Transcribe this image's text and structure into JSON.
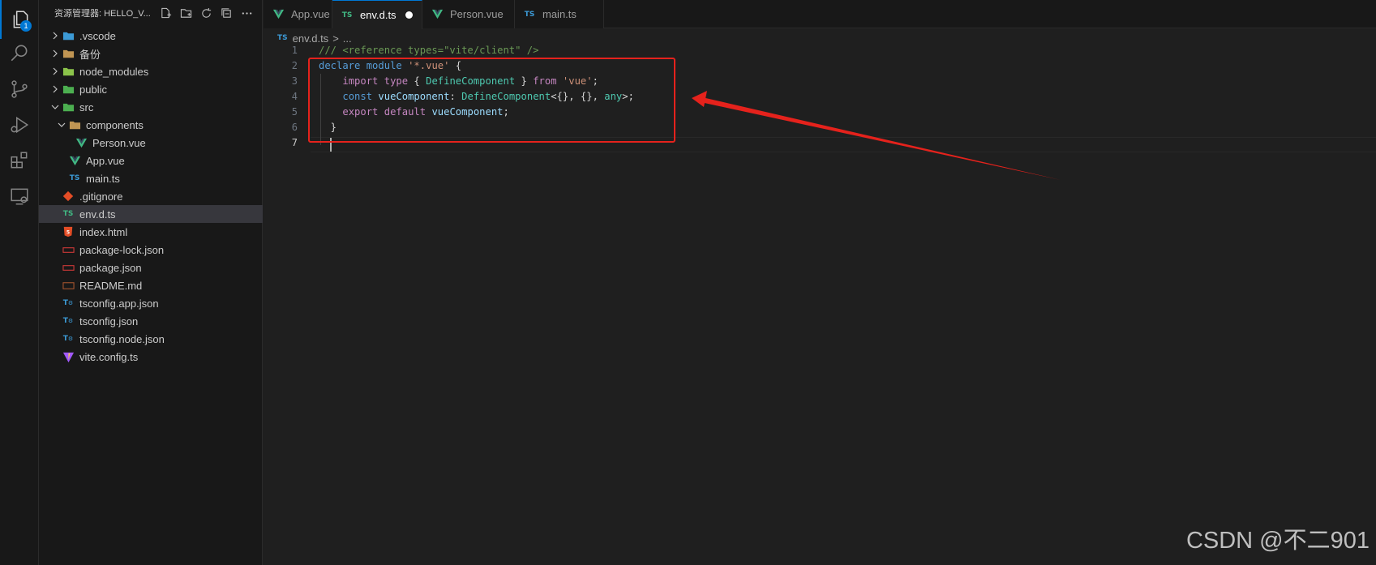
{
  "activity_bar": {
    "explorer_badge": "1",
    "items": [
      "explorer-icon",
      "search-icon",
      "source-control-icon",
      "run-debug-icon",
      "extensions-icon",
      "remote-explorer-icon"
    ]
  },
  "sidebar": {
    "title": "资源管理器: HELLO_V...",
    "actions": [
      "new-file-icon",
      "new-folder-icon",
      "refresh-icon",
      "collapse-all-icon",
      "more-icon"
    ],
    "tree": [
      {
        "label": ".vscode",
        "type": "folder",
        "expanded": false,
        "indent": 0,
        "icon": "vscode-folder-icon",
        "color": "#3c9ad6"
      },
      {
        "label": "备份",
        "type": "folder",
        "expanded": false,
        "indent": 0,
        "icon": "folder-icon",
        "color": "#c09553"
      },
      {
        "label": "node_modules",
        "type": "folder",
        "expanded": false,
        "indent": 0,
        "icon": "node-folder-icon",
        "color": "#8bc34a"
      },
      {
        "label": "public",
        "type": "folder",
        "expanded": false,
        "indent": 0,
        "icon": "public-folder-icon",
        "color": "#4caf50"
      },
      {
        "label": "src",
        "type": "folder",
        "expanded": true,
        "indent": 0,
        "icon": "src-folder-icon",
        "color": "#4caf50"
      },
      {
        "label": "components",
        "type": "folder",
        "expanded": true,
        "indent": 1,
        "icon": "components-folder-icon",
        "color": "#c09553"
      },
      {
        "label": "Person.vue",
        "type": "file",
        "indent": 2,
        "icon": "vue-file-icon",
        "color": "#41b883"
      },
      {
        "label": "App.vue",
        "type": "file",
        "indent": 1,
        "icon": "vue-file-icon",
        "color": "#41b883"
      },
      {
        "label": "main.ts",
        "type": "file",
        "indent": 1,
        "icon": "ts-file-icon",
        "color": "#3c9ad6"
      },
      {
        "label": ".gitignore",
        "type": "file",
        "indent": 0,
        "icon": "git-file-icon",
        "color": "#e44d26"
      },
      {
        "label": "env.d.ts",
        "type": "file",
        "indent": 0,
        "icon": "ts-file-icon",
        "color": "#41b883",
        "selected": true
      },
      {
        "label": "index.html",
        "type": "file",
        "indent": 0,
        "icon": "html-file-icon",
        "color": "#e44d26"
      },
      {
        "label": "package-lock.json",
        "type": "file",
        "indent": 0,
        "icon": "npm-file-icon",
        "color": "#cb3837"
      },
      {
        "label": "package.json",
        "type": "file",
        "indent": 0,
        "icon": "npm-file-icon",
        "color": "#cb3837"
      },
      {
        "label": "README.md",
        "type": "file",
        "indent": 0,
        "icon": "markdown-file-icon",
        "color": "#a0522d"
      },
      {
        "label": "tsconfig.app.json",
        "type": "file",
        "indent": 0,
        "icon": "tsconfig-file-icon",
        "color": "#3c9ad6"
      },
      {
        "label": "tsconfig.json",
        "type": "file",
        "indent": 0,
        "icon": "tsconfig-file-icon",
        "color": "#3c9ad6"
      },
      {
        "label": "tsconfig.node.json",
        "type": "file",
        "indent": 0,
        "icon": "tsconfig-file-icon",
        "color": "#3c9ad6"
      },
      {
        "label": "vite.config.ts",
        "type": "file",
        "indent": 0,
        "icon": "vite-file-icon",
        "color": "#a259ff"
      }
    ]
  },
  "tabs": [
    {
      "label": "App.vue",
      "icon": "vue-file-icon",
      "active": false,
      "dirty": false
    },
    {
      "label": "env.d.ts",
      "icon": "ts-file-icon",
      "active": true,
      "dirty": true
    },
    {
      "label": "Person.vue",
      "icon": "vue-file-icon",
      "active": false,
      "dirty": false
    },
    {
      "label": "main.ts",
      "icon": "ts-file-icon",
      "active": false,
      "dirty": false
    }
  ],
  "breadcrumb": {
    "icon": "TS",
    "file": "env.d.ts",
    "separator": ">",
    "more": "..."
  },
  "editor": {
    "current_line": 7,
    "lines": [
      "1",
      "2",
      "3",
      "4",
      "5",
      "6",
      "7"
    ],
    "code": [
      "/// <reference types=\"vite/client\" />",
      "declare module '*.vue' {",
      "    import type { DefineComponent } from 'vue';",
      "    const vueComponent: DefineComponent<{}, {}, any>;",
      "    export default vueComponent;",
      "  }",
      ""
    ]
  },
  "icon_text": {
    "ts": "TS",
    "vue": "V"
  },
  "watermark": "CSDN @不二901",
  "colors": {
    "accent": "#0078d4",
    "annotation_red": "#e5221c"
  }
}
